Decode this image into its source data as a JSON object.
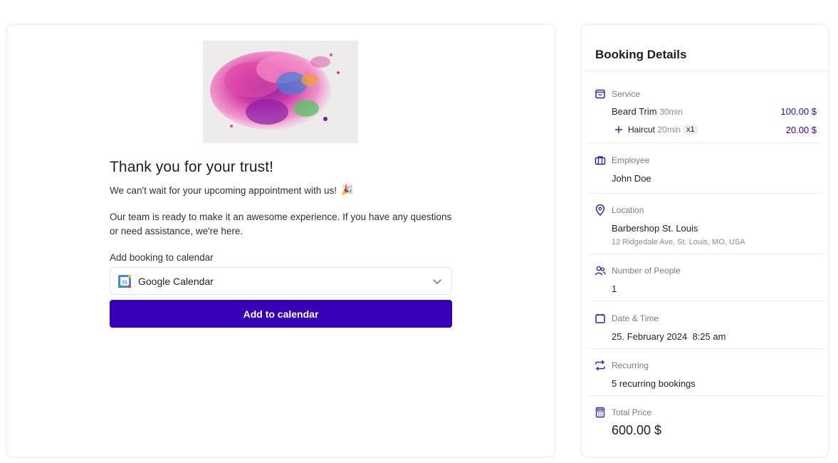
{
  "main": {
    "title": "Thank you for your trust!",
    "subtitle": "We can't wait for your upcoming appointment with us!",
    "subtitle_emoji": "🎉",
    "paragraph": "Our team is ready to make it an awesome experience. If you have any questions or need assistance, we're here.",
    "calendar_label": "Add booking to calendar",
    "calendar_select": {
      "value": "Google Calendar",
      "icon": "google-calendar-icon"
    },
    "add_button": "Add to calendar"
  },
  "side": {
    "title": "Booking Details",
    "service": {
      "label": "Service",
      "main": {
        "name": "Beard Trim",
        "duration": "30min",
        "price": "100.00 $"
      },
      "extra": {
        "name": "Haircut",
        "duration": "20min",
        "qty": "x1",
        "price": "20.00 $"
      }
    },
    "employee": {
      "label": "Employee",
      "value": "John Doe"
    },
    "location": {
      "label": "Location",
      "name": "Barbershop St. Louis",
      "address": "12 Ridgedale Ave, St. Louis, MO, USA"
    },
    "people": {
      "label": "Number of People",
      "value": "1"
    },
    "datetime": {
      "label": "Date & Time",
      "date": "25. February 2024",
      "time": "8:25 am"
    },
    "recurring": {
      "label": "Recurring",
      "value": "5 recurring bookings"
    },
    "total": {
      "label": "Total Price",
      "value": "600.00 $"
    }
  },
  "colors": {
    "accent": "#3700b8",
    "icon": "#3b1fa8"
  }
}
